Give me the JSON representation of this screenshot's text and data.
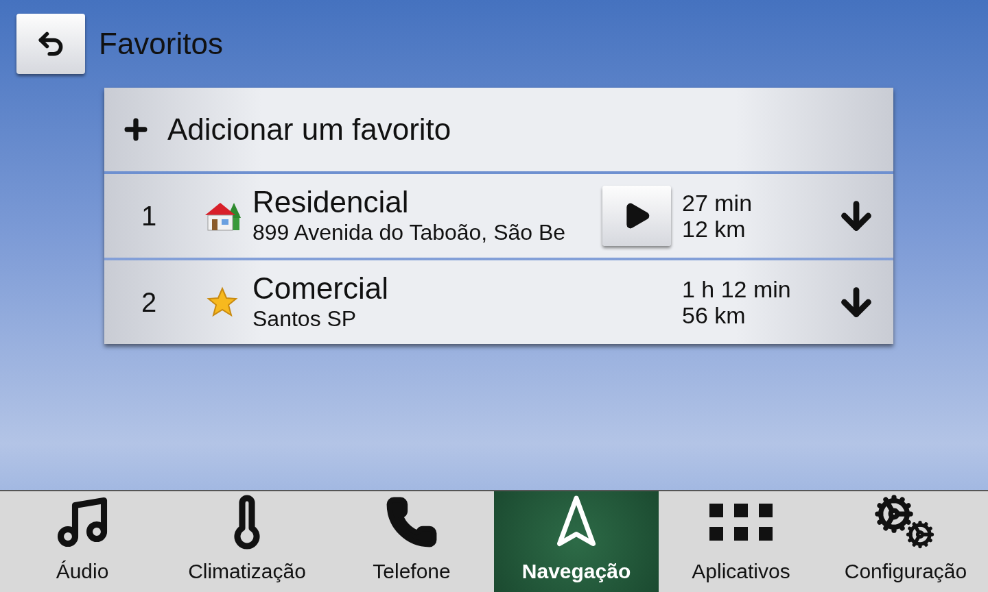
{
  "header": {
    "title": "Favoritos"
  },
  "add_item": {
    "label": "Adicionar um favorito"
  },
  "favorites": [
    {
      "number": "1",
      "name": "Residencial",
      "address": "899 Avenida do Taboão, São Be",
      "duration": "27 min",
      "distance": "12 km",
      "selected": true
    },
    {
      "number": "2",
      "name": "Comercial",
      "address": "Santos SP",
      "duration": "1 h 12 min",
      "distance": "56 km",
      "selected": false
    }
  ],
  "nav_bar": [
    {
      "label": "Áudio",
      "selected": false
    },
    {
      "label": "Climatização",
      "selected": false
    },
    {
      "label": "Telefone",
      "selected": false
    },
    {
      "label": "Navegação",
      "selected": true
    },
    {
      "label": "Aplicativos",
      "selected": false
    },
    {
      "label": "Configuração",
      "selected": false
    }
  ]
}
